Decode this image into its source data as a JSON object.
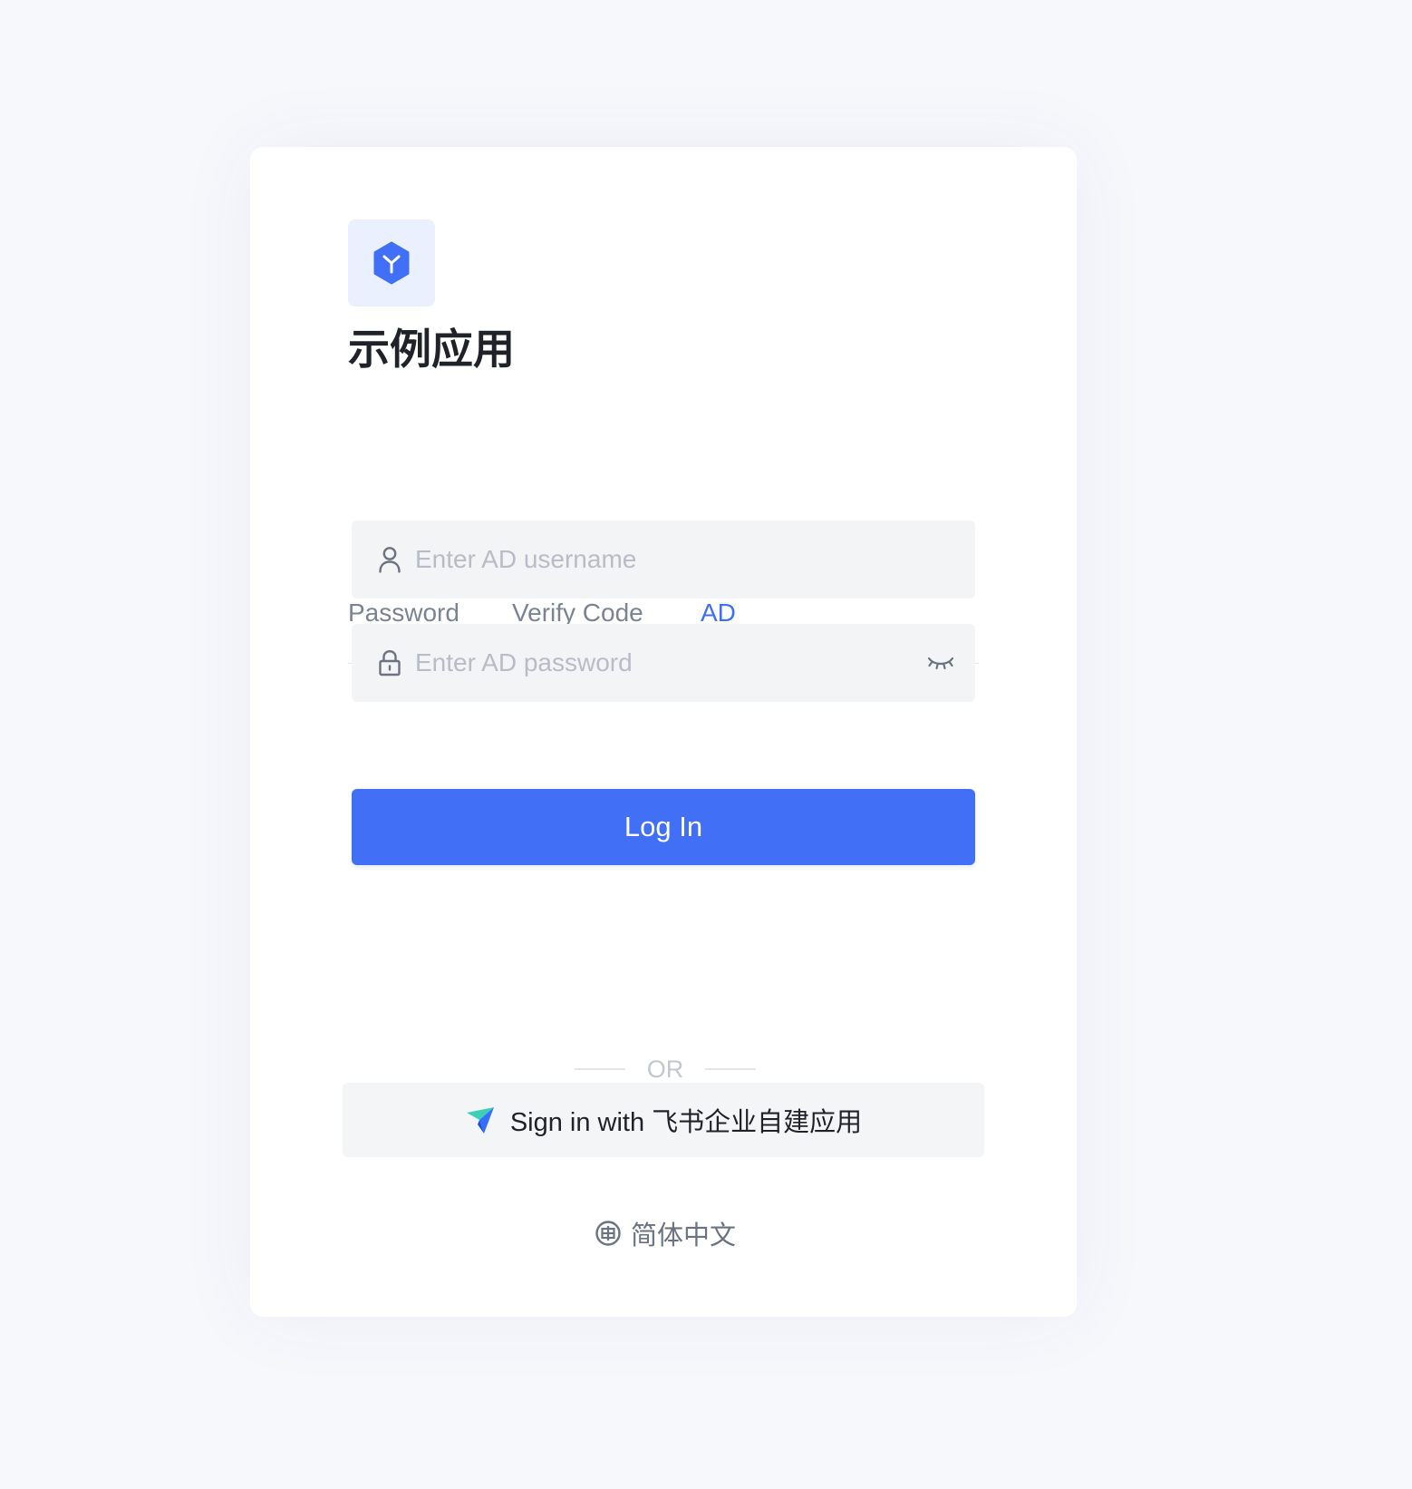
{
  "app": {
    "title": "示例应用"
  },
  "tabs": [
    {
      "label": "Password",
      "active": false
    },
    {
      "label": "Verify Code",
      "active": false
    },
    {
      "label": "AD",
      "active": true
    }
  ],
  "form": {
    "username": {
      "value": "",
      "placeholder": "Enter AD username",
      "icon": "user-icon"
    },
    "password": {
      "value": "",
      "placeholder": "Enter AD password",
      "icon": "lock-icon",
      "toggle_icon": "eye-closed-icon"
    },
    "login_label": "Log In"
  },
  "divider": {
    "text": "OR"
  },
  "sso": {
    "label": "Sign in with 飞书企业自建应用",
    "icon": "feishu-logo-icon"
  },
  "language": {
    "label": "简体中文",
    "icon": "globe-icon"
  },
  "colors": {
    "accent": "#4170f6",
    "page_background": "#f7f8fc",
    "card_background": "#ffffff",
    "input_background": "#f3f4f6",
    "title_text": "#1f2329",
    "muted_text": "#7a8394"
  }
}
